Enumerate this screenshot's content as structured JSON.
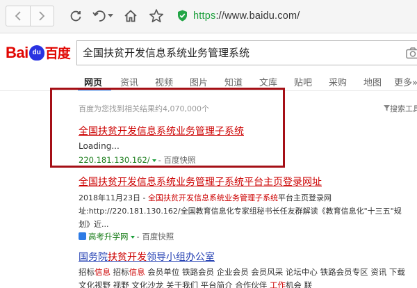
{
  "browser": {
    "url_scheme": "https",
    "url_rest": "://www.baidu.com/"
  },
  "logo": {
    "text_latin": "Bai",
    "paw_text": "du",
    "text_cn": "百度"
  },
  "search": {
    "query": "全国扶贫开发信息系统业务管理系统"
  },
  "tabs": [
    "网页",
    "资讯",
    "视频",
    "图片",
    "知道",
    "文库",
    "贴吧",
    "采购",
    "地图",
    "更多»"
  ],
  "stats": "百度为您找到相关结果约4,070,000个",
  "tools_link": "搜索工具",
  "results": [
    {
      "title": "全国扶贫开发信息系统业务管理子系统",
      "snippet": "Loading...",
      "url": "220.181.130.162/",
      "snapshot": "百度快照"
    },
    {
      "title": "全国扶贫开发信息系统业务管理子系统平台主页登录网址",
      "date": "2018年11月23日",
      "snippet_em": "全国扶贫开发信息系统业务管理子系统",
      "snippet_rest": "平台主页登录网",
      "snippet_line2": "址:http://220.181.130.162/全国教育信息化专家组秘书长任友群解读《教育信息化\"十三五\"规",
      "snippet_line3": "划》近...",
      "source": "高考升学网",
      "snapshot": "百度快照"
    },
    {
      "title_pre": "国务院",
      "title_em1": "扶贫开发",
      "title_mid": "领导小组办公室",
      "line1_parts": [
        "招标",
        "信息",
        " 招标",
        "信息",
        " 会员单位 铁路会员 企业会员 会员风采 论坛中心 铁路会员专区 资讯 下载"
      ],
      "line2_pre": "文化视野 视野 文化沙龙 关于我们 平台简介 合作伙伴 ",
      "line2_em": "工作",
      "line2_post": "机会 联"
    }
  ],
  "colors": {
    "link_blue": "#2440b3",
    "link_red": "#c00000",
    "url_green": "#1a7d1a",
    "highlight_box": "#a50f16",
    "tab_active": "#3388ff"
  }
}
